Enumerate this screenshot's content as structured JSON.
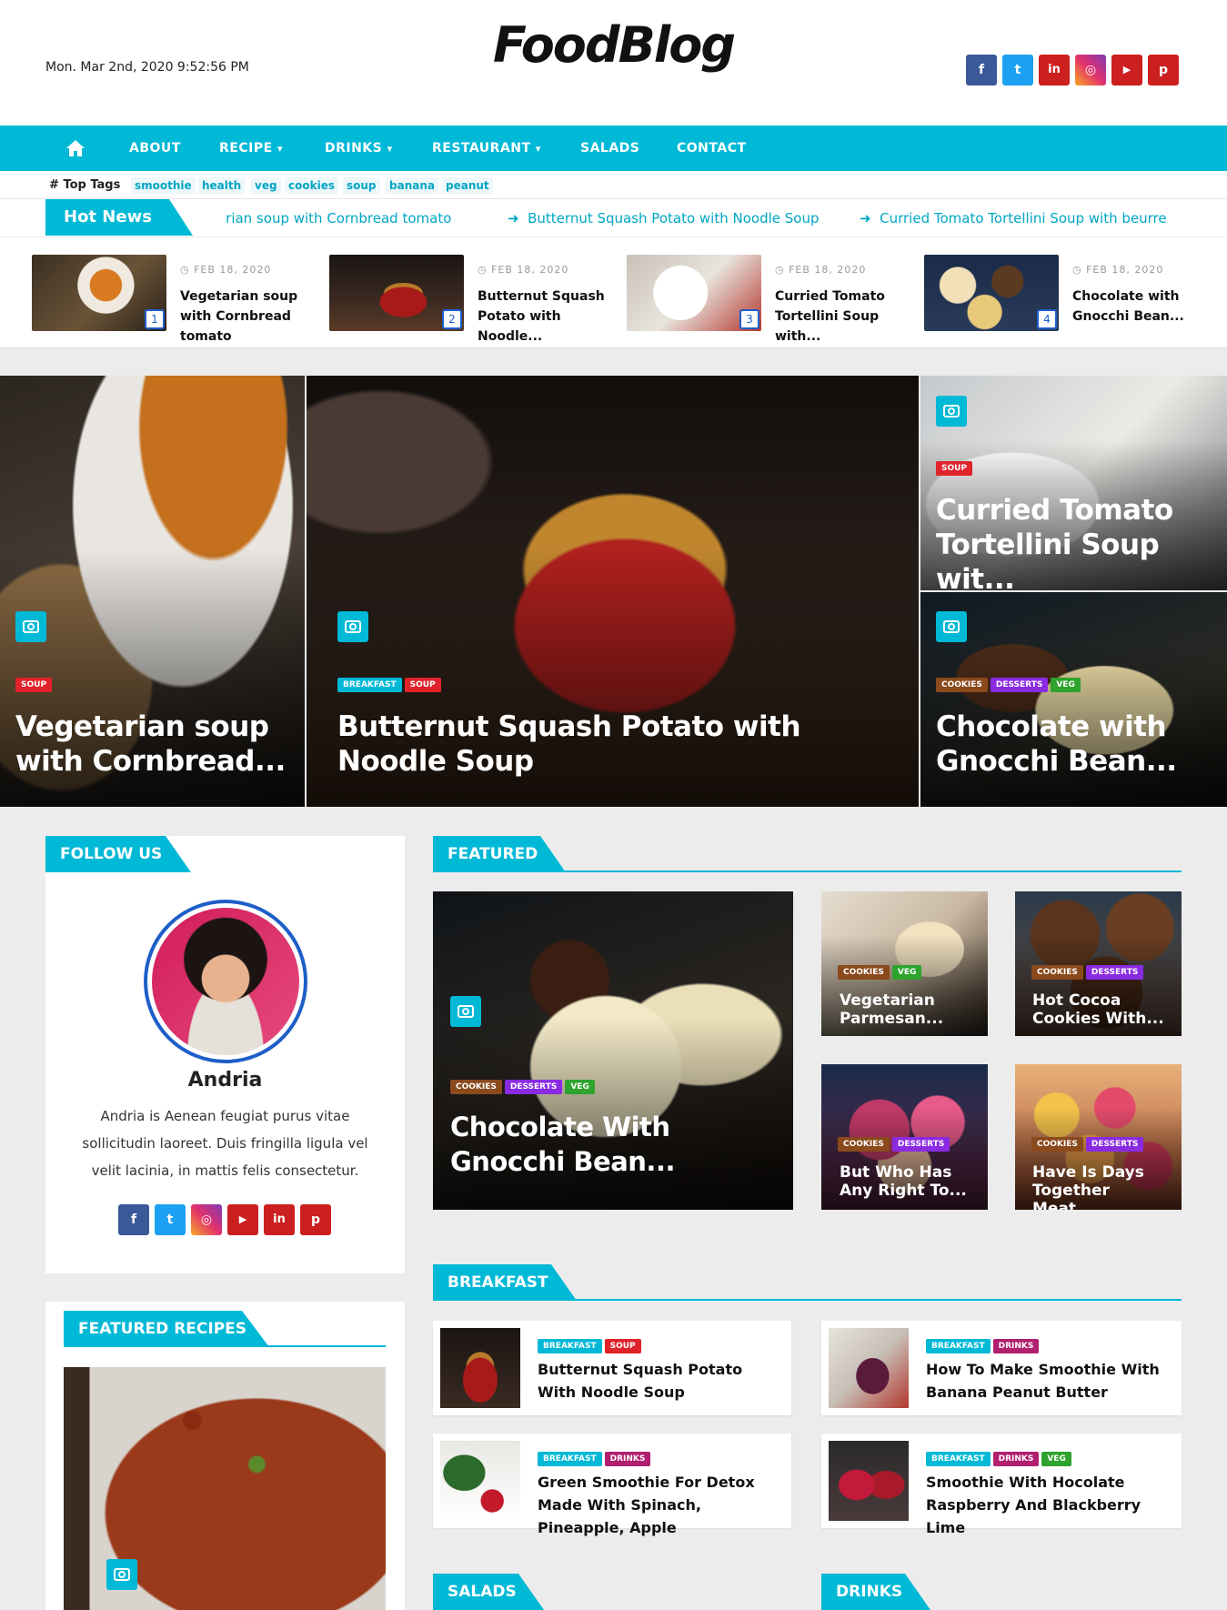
{
  "header": {
    "datetime": "Mon. Mar 2nd, 2020 9:52:56 PM",
    "logo": "FoodBlog",
    "social": [
      {
        "name": "facebook-icon",
        "glyph": "f",
        "color": "#3b5998"
      },
      {
        "name": "twitter-icon",
        "glyph": "t",
        "color": "#1da1f2"
      },
      {
        "name": "linkedin-icon",
        "glyph": "in",
        "color": "#cc1f1f"
      },
      {
        "name": "instagram-icon",
        "glyph": "◎",
        "color": "#e1306c"
      },
      {
        "name": "youtube-icon",
        "glyph": "▶",
        "color": "#cc1f1f"
      },
      {
        "name": "pinterest-icon",
        "glyph": "p",
        "color": "#cc1f1f"
      }
    ]
  },
  "nav": {
    "home_icon": "home-icon",
    "items": [
      "ABOUT",
      "RECIPE",
      "DRINKS",
      "RESTAURANT",
      "SALADS",
      "CONTACT"
    ],
    "dropdown_glyph": "⌄"
  },
  "top_tags": {
    "label": "Top Tags",
    "hash": "#",
    "tags": [
      "smoothie",
      "health",
      "veg",
      "cookies",
      "soup",
      "banana",
      "peanut"
    ]
  },
  "hot_news": {
    "label": "Hot News",
    "items": [
      "Vegetarian soup with Cornbread tomato",
      "Butternut Squash Potato with Noodle Soup",
      "Curried Tomato Tortellini Soup with beurre"
    ]
  },
  "strip": [
    {
      "num": "1",
      "date": "FEB 18, 2020",
      "title": "Vegetarian soup with Cornbread tomato"
    },
    {
      "num": "2",
      "date": "FEB 18, 2020",
      "title": "Butternut Squash Potato with Noodle..."
    },
    {
      "num": "3",
      "date": "FEB 18, 2020",
      "title": "Curried Tomato Tortellini Soup with..."
    },
    {
      "num": "4",
      "date": "FEB 18, 2020",
      "title": "Chocolate with Gnocchi Bean..."
    }
  ],
  "hero": [
    {
      "cats": [
        "SOUP"
      ],
      "title": "Vegetarian soup with Cornbread..."
    },
    {
      "cats": [
        "BREAKFAST",
        "SOUP"
      ],
      "title": "Butternut Squash Potato with Noodle Soup"
    },
    {
      "cats": [
        "SOUP"
      ],
      "title": "Curried Tomato Tortellini Soup wit..."
    },
    {
      "cats": [
        "COOKIES",
        "DESSERTS",
        "VEG"
      ],
      "title": "Chocolate with Gnocchi Bean..."
    }
  ],
  "follow": {
    "heading": "FOLLOW US",
    "name": "Andria",
    "bio": "Andria is Aenean feugiat purus vitae sollicitudin laoreet. Duis fringilla ligula vel velit lacinia, in mattis felis consectetur."
  },
  "featured_recipes": {
    "heading": "FEATURED RECIPES"
  },
  "featured": {
    "heading": "FEATURED",
    "main": {
      "cats": [
        "COOKIES",
        "DESSERTS",
        "VEG"
      ],
      "title": "Chocolate With Gnocchi Bean..."
    },
    "grid": [
      {
        "cats": [
          "COOKIES",
          "VEG"
        ],
        "title": "Vegetarian Parmesan..."
      },
      {
        "cats": [
          "COOKIES",
          "DESSERTS"
        ],
        "title": "Hot Cocoa Cookies With..."
      },
      {
        "cats": [
          "COOKIES",
          "DESSERTS"
        ],
        "title": "But Who Has Any Right To..."
      },
      {
        "cats": [
          "COOKIES",
          "DESSERTS"
        ],
        "title": "Have Is Days Together Meat..."
      }
    ]
  },
  "breakfast": {
    "heading": "BREAKFAST",
    "items": [
      {
        "cats": [
          "BREAKFAST",
          "SOUP"
        ],
        "title": "Butternut Squash Potato With Noodle Soup"
      },
      {
        "cats": [
          "BREAKFAST",
          "DRINKS"
        ],
        "title": "How To Make Smoothie With Banana Peanut Butter"
      },
      {
        "cats": [
          "BREAKFAST",
          "DRINKS"
        ],
        "title": "Green Smoothie For Detox Made With Spinach, Pineapple, Apple"
      },
      {
        "cats": [
          "BREAKFAST",
          "DRINKS",
          "VEG"
        ],
        "title": "Smoothie With Hocolate Raspberry And Blackberry Lime"
      }
    ]
  },
  "salads": {
    "heading": "SALADS"
  },
  "drinks": {
    "heading": "DRINKS"
  },
  "colors": {
    "accent": "#00b9d6",
    "soup": "#e0232b",
    "cookies": "#8a4a1c",
    "desserts": "#8a2be2",
    "veg": "#2ea32e",
    "drinks": "#b0206e"
  }
}
